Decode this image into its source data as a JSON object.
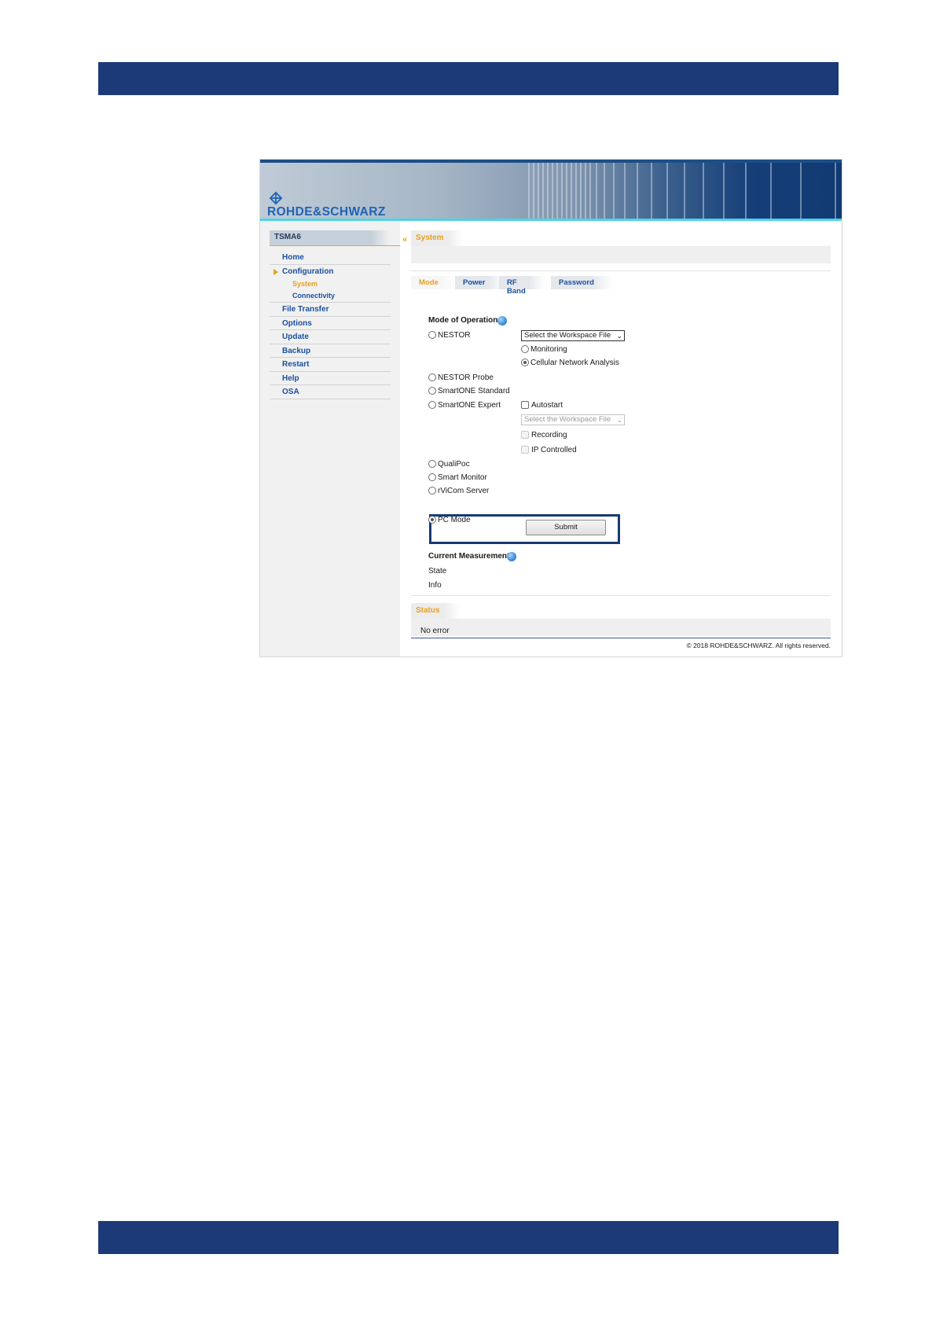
{
  "brand": {
    "logo_text": "ROHDE&SCHWARZ"
  },
  "colors": {
    "band": "#1c3a78",
    "nav_link": "#1b4f9c",
    "accent": "#e8a020",
    "highlight": "#173a72"
  },
  "sidebar": {
    "header": "TSMA6",
    "items": [
      {
        "label": "Home"
      },
      {
        "label": "Configuration",
        "expanded": true,
        "children": [
          {
            "label": "System",
            "active": true
          },
          {
            "label": "Connectivity"
          }
        ]
      },
      {
        "label": "File Transfer"
      },
      {
        "label": "Options"
      },
      {
        "label": "Update"
      },
      {
        "label": "Backup"
      },
      {
        "label": "Restart"
      },
      {
        "label": "Help"
      },
      {
        "label": "OSA"
      }
    ]
  },
  "main": {
    "section_title": "System",
    "tabs": [
      {
        "label": "Mode",
        "active": true
      },
      {
        "label": "Power"
      },
      {
        "label": "RF Band"
      },
      {
        "label": "Password"
      }
    ],
    "mode_of_operation": {
      "title": "Mode of Operation",
      "options": {
        "nestor": {
          "label": "NESTOR",
          "selected": false
        },
        "nestor_probe": {
          "label": "NESTOR Probe",
          "selected": false
        },
        "smartone_standard": {
          "label": "SmartONE Standard",
          "selected": false
        },
        "smartone_expert": {
          "label": "SmartONE Expert",
          "selected": false
        },
        "qualipoc": {
          "label": "QualiPoc",
          "selected": false
        },
        "smart_monitor": {
          "label": "Smart Monitor",
          "selected": false
        },
        "rvicom_server": {
          "label": "rViCom Server",
          "selected": false
        },
        "pc_mode": {
          "label": "PC Mode",
          "selected": true
        }
      },
      "nestor_settings": {
        "workspace_select": "Select the Workspace File",
        "monitoring": {
          "label": "Monitoring",
          "selected": false
        },
        "cellular": {
          "label": "Cellular Network Analysis",
          "selected": true
        }
      },
      "expert_settings": {
        "autostart": {
          "label": "Autostart",
          "checked": false
        },
        "workspace_select": "Select the Workspace File",
        "recording": {
          "label": "Recording",
          "checked": false
        },
        "ip_controlled": {
          "label": "IP Controlled",
          "checked": false
        }
      },
      "submit_label": "Submit"
    },
    "current_measurement": {
      "title": "Current Measurement",
      "state_label": "State",
      "info_label": "Info"
    },
    "status": {
      "title": "Status",
      "message": "No error"
    },
    "copyright": "© 2018 ROHDE&SCHWARZ. All rights reserved."
  }
}
